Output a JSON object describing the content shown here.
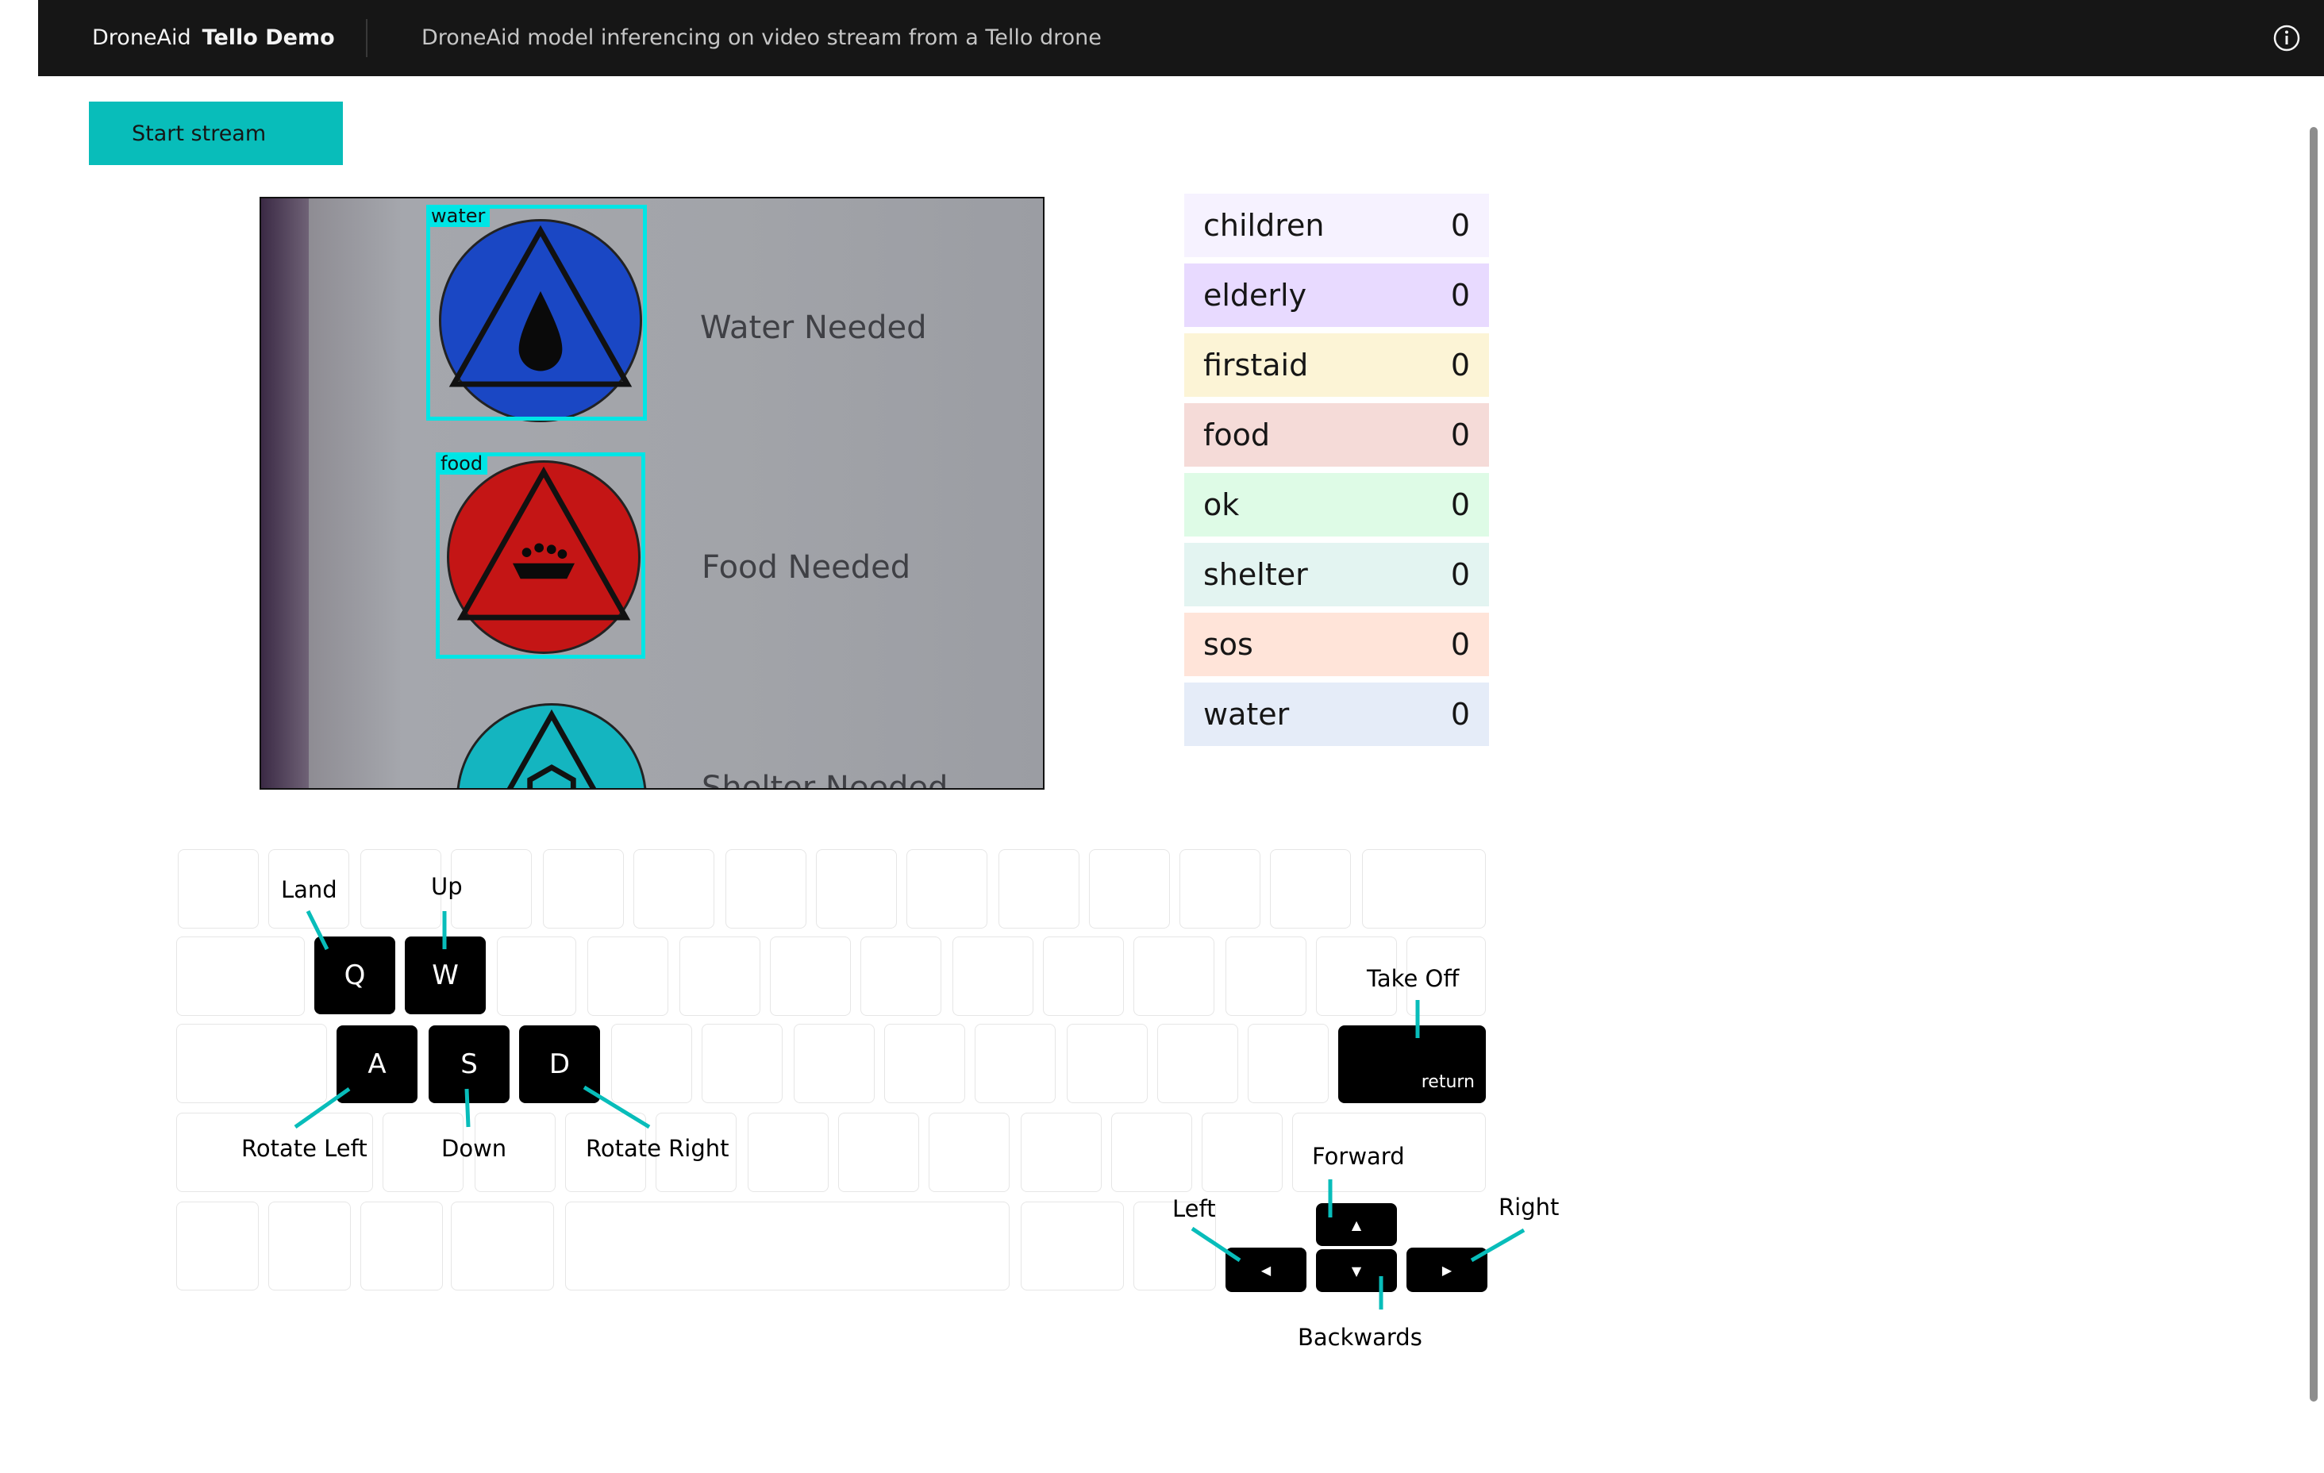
{
  "header": {
    "brand_prefix": "DroneAid",
    "brand_name": "Tello Demo",
    "subtitle": "DroneAid model inferencing on video stream from a Tello drone",
    "info_icon": "info-icon"
  },
  "controls": {
    "start_label": "Start stream"
  },
  "video": {
    "detections": [
      {
        "label": "water"
      },
      {
        "label": "food"
      }
    ],
    "signs": [
      {
        "text": "Water Needed"
      },
      {
        "text": "Food Needed"
      },
      {
        "text": "Shelter Needed"
      }
    ]
  },
  "counts": [
    {
      "label": "children",
      "value": "0",
      "color": "#f6f2ff"
    },
    {
      "label": "elderly",
      "value": "0",
      "color": "#e8daff"
    },
    {
      "label": "firstaid",
      "value": "0",
      "color": "#fcf4d6"
    },
    {
      "label": "food",
      "value": "0",
      "color": "#f5dbd8"
    },
    {
      "label": "ok",
      "value": "0",
      "color": "#defbe6"
    },
    {
      "label": "shelter",
      "value": "0",
      "color": "#e3f4f1"
    },
    {
      "label": "sos",
      "value": "0",
      "color": "#ffe4d9"
    },
    {
      "label": "water",
      "value": "0",
      "color": "#e5ecf8"
    }
  ],
  "keyboard": {
    "keys": {
      "q": "Q",
      "w": "W",
      "a": "A",
      "s": "S",
      "d": "D",
      "return": "return",
      "up": "▲",
      "down": "▼",
      "left": "◀",
      "right": "▶"
    },
    "labels": {
      "land": "Land",
      "up": "Up",
      "take_off": "Take Off",
      "rotate_left": "Rotate Left",
      "down": "Down",
      "rotate_right": "Rotate Right",
      "forward": "Forward",
      "left": "Left",
      "right": "Right",
      "backwards": "Backwards"
    }
  }
}
